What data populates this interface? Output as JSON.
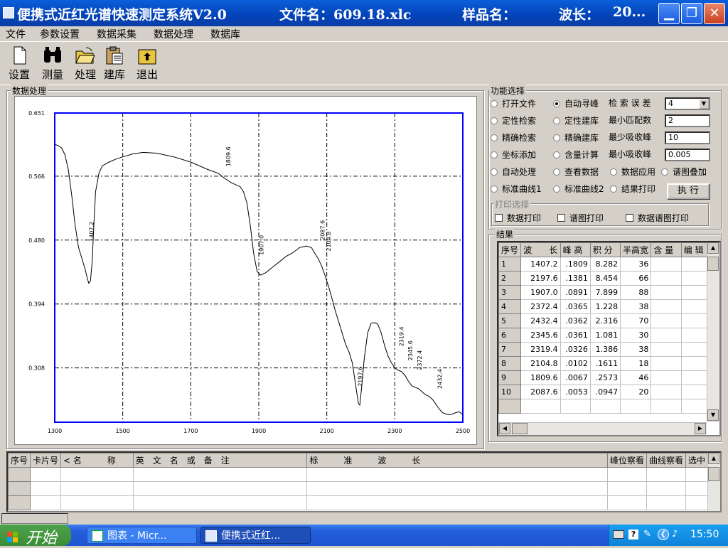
{
  "titlebar": {
    "app": "便携式近红光谱快速测定系统V2.0",
    "file": "文件名：609.18.xlc",
    "sample": "样品名：",
    "wave": "波长：",
    "wave_val": "20..."
  },
  "menu": [
    "文件",
    "参数设置",
    "数据采集",
    "数据处理",
    "数据库"
  ],
  "toolbar": [
    {
      "label": "设置",
      "icon": "document-icon"
    },
    {
      "label": "测量",
      "icon": "binoculars-icon"
    },
    {
      "label": "处理",
      "icon": "folder-open-icon"
    },
    {
      "label": "建库",
      "icon": "clipboard-icon"
    },
    {
      "label": "退出",
      "icon": "exit-icon"
    }
  ],
  "chart_panel": {
    "title": "数据处理"
  },
  "chart_data": {
    "type": "line",
    "x_ticks": [
      "1300",
      "1500",
      "1700",
      "1900",
      "2100",
      "2300",
      "2500"
    ],
    "y_ticks": [
      "0.651",
      "0.566",
      "0.480",
      "0.394",
      "0.308"
    ],
    "xlim": [
      1300,
      2500
    ],
    "ylim": [
      0.235,
      0.651
    ],
    "grid": true,
    "series": [
      {
        "points": [
          [
            1300,
            0.609
          ],
          [
            1310,
            0.607
          ],
          [
            1320,
            0.604
          ],
          [
            1330,
            0.595
          ],
          [
            1340,
            0.575
          ],
          [
            1350,
            0.54
          ],
          [
            1360,
            0.5
          ],
          [
            1370,
            0.47
          ],
          [
            1380,
            0.455
          ],
          [
            1390,
            0.44
          ],
          [
            1395,
            0.43
          ],
          [
            1400,
            0.422
          ],
          [
            1405,
            0.425
          ],
          [
            1410,
            0.45
          ],
          [
            1415,
            0.5
          ],
          [
            1420,
            0.545
          ],
          [
            1430,
            0.57
          ],
          [
            1440,
            0.58
          ],
          [
            1460,
            0.585
          ],
          [
            1480,
            0.589
          ],
          [
            1500,
            0.592
          ],
          [
            1530,
            0.596
          ],
          [
            1560,
            0.598
          ],
          [
            1600,
            0.597
          ],
          [
            1650,
            0.592
          ],
          [
            1700,
            0.585
          ],
          [
            1750,
            0.575
          ],
          [
            1780,
            0.57
          ],
          [
            1800,
            0.563
          ],
          [
            1820,
            0.557
          ],
          [
            1835,
            0.554
          ],
          [
            1845,
            0.552
          ],
          [
            1855,
            0.545
          ],
          [
            1865,
            0.53
          ],
          [
            1875,
            0.5
          ],
          [
            1885,
            0.462
          ],
          [
            1895,
            0.438
          ],
          [
            1905,
            0.433
          ],
          [
            1920,
            0.436
          ],
          [
            1950,
            0.447
          ],
          [
            1980,
            0.458
          ],
          [
            2000,
            0.463
          ],
          [
            2020,
            0.47
          ],
          [
            2040,
            0.472
          ],
          [
            2055,
            0.47
          ],
          [
            2065,
            0.462
          ],
          [
            2075,
            0.455
          ],
          [
            2085,
            0.445
          ],
          [
            2095,
            0.432
          ],
          [
            2105,
            0.418
          ],
          [
            2115,
            0.402
          ],
          [
            2125,
            0.385
          ],
          [
            2135,
            0.37
          ],
          [
            2145,
            0.355
          ],
          [
            2155,
            0.34
          ],
          [
            2165,
            0.33
          ],
          [
            2175,
            0.315
          ],
          [
            2180,
            0.3
          ],
          [
            2187,
            0.278
          ],
          [
            2193,
            0.26
          ],
          [
            2197,
            0.258
          ],
          [
            2202,
            0.28
          ],
          [
            2210,
            0.32
          ],
          [
            2220,
            0.355
          ],
          [
            2230,
            0.368
          ],
          [
            2240,
            0.369
          ],
          [
            2250,
            0.367
          ],
          [
            2260,
            0.355
          ],
          [
            2270,
            0.338
          ],
          [
            2280,
            0.324
          ],
          [
            2290,
            0.315
          ],
          [
            2300,
            0.308
          ],
          [
            2310,
            0.305
          ],
          [
            2320,
            0.303
          ],
          [
            2330,
            0.298
          ],
          [
            2340,
            0.29
          ],
          [
            2350,
            0.284
          ],
          [
            2360,
            0.282
          ],
          [
            2370,
            0.28
          ],
          [
            2380,
            0.276
          ],
          [
            2390,
            0.272
          ],
          [
            2400,
            0.27
          ],
          [
            2410,
            0.266
          ],
          [
            2420,
            0.26
          ],
          [
            2430,
            0.253
          ],
          [
            2440,
            0.248
          ],
          [
            2450,
            0.246
          ],
          [
            2460,
            0.245
          ],
          [
            2470,
            0.246
          ],
          [
            2480,
            0.248
          ],
          [
            2490,
            0.249
          ],
          [
            2500,
            0.245
          ]
        ]
      }
    ],
    "annotations": [
      {
        "x": 1407.2,
        "y": 0.478,
        "text": "1407.2"
      },
      {
        "x": 1809.6,
        "y": 0.579,
        "text": "1809.6"
      },
      {
        "x": 1907.0,
        "y": 0.46,
        "text": "1907.0"
      },
      {
        "x": 2087.6,
        "y": 0.48,
        "text": "2087.6"
      },
      {
        "x": 2104.8,
        "y": 0.465,
        "text": "2104.8"
      },
      {
        "x": 2197.6,
        "y": 0.283,
        "text": "2197.6"
      },
      {
        "x": 2319.4,
        "y": 0.337,
        "text": "2319.4"
      },
      {
        "x": 2345.6,
        "y": 0.318,
        "text": "2345.6"
      },
      {
        "x": 2372.4,
        "y": 0.305,
        "text": "2372.4"
      },
      {
        "x": 2432.4,
        "y": 0.28,
        "text": "2432.4"
      }
    ]
  },
  "func": {
    "title": "功能选择",
    "radios": [
      {
        "label": "打开文件",
        "on": false
      },
      {
        "label": "自动寻峰",
        "on": true
      },
      {
        "label": "定性检索",
        "on": false
      },
      {
        "label": "定性建库",
        "on": false
      },
      {
        "label": "精确检索",
        "on": false
      },
      {
        "label": "精确建库",
        "on": false
      },
      {
        "label": "坐标添加",
        "on": false
      },
      {
        "label": "含量计算",
        "on": false
      },
      {
        "label": "自动处理",
        "on": false
      },
      {
        "label": "查看数据",
        "on": false
      },
      {
        "label": "数据应用",
        "on": false
      },
      {
        "label": "谱图叠加",
        "on": false
      },
      {
        "label": "标准曲线1",
        "on": false
      },
      {
        "label": "标准曲线2",
        "on": false
      },
      {
        "label": "结果打印",
        "on": false
      }
    ],
    "params": [
      {
        "label": "检 索 误 差",
        "value": "4"
      },
      {
        "label": "最小匹配数",
        "value": "2"
      },
      {
        "label": "最少吸收峰",
        "value": "10"
      },
      {
        "label": "最小吸收峰",
        "value": "0.005"
      }
    ],
    "exec": "执 行"
  },
  "print": {
    "title": "打印选择",
    "options": [
      "数据打印",
      "谱图打印",
      "数据谱图打印"
    ]
  },
  "results": {
    "title": "结果",
    "headers": [
      "序号",
      "波　　长",
      "峰 高",
      "积 分",
      "半高宽",
      "含 量",
      "编 辑"
    ],
    "rows": [
      [
        "1",
        "1407.2",
        ".1809",
        "8.282",
        "36"
      ],
      [
        "2",
        "2197.6",
        ".1381",
        "8.454",
        "66"
      ],
      [
        "3",
        "1907.0",
        ".0891",
        "7.899",
        "88"
      ],
      [
        "4",
        "2372.4",
        ".0365",
        "1.228",
        "38"
      ],
      [
        "5",
        "2432.4",
        ".0362",
        "2.316",
        "70"
      ],
      [
        "6",
        "2345.6",
        ".0361",
        "1.081",
        "30"
      ],
      [
        "7",
        "2319.4",
        ".0326",
        "1.386",
        "38"
      ],
      [
        "8",
        "2104.8",
        ".0102",
        ".1611",
        "18"
      ],
      [
        "9",
        "1809.6",
        ".0067",
        ".2573",
        "46"
      ],
      [
        "10",
        "2087.6",
        ".0053",
        ".0947",
        "20"
      ]
    ]
  },
  "bottom": {
    "headers": [
      "序号",
      "卡片号",
      "< 名　　　称",
      "英　文　名　或　备　注",
      "标　　　准　　　波　　　长",
      "峰位察看",
      "曲线察看",
      "选中"
    ]
  },
  "taskbar": {
    "start": "开始",
    "tasks": [
      "图表 - Micr...",
      "便携式近红..."
    ],
    "time": "15:50"
  }
}
